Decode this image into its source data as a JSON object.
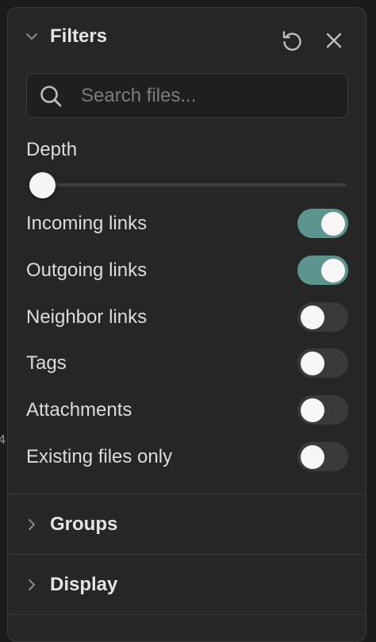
{
  "background_glyph": "4",
  "filters": {
    "title": "Filters",
    "reset_icon": "rotate-ccw-icon",
    "close_icon": "close-icon",
    "search": {
      "placeholder": "Search files...",
      "value": ""
    },
    "depth": {
      "label": "Depth",
      "value_fraction": 0
    },
    "toggles": [
      {
        "label": "Incoming links",
        "on": true
      },
      {
        "label": "Outgoing links",
        "on": true
      },
      {
        "label": "Neighbor links",
        "on": false
      },
      {
        "label": "Tags",
        "on": false
      },
      {
        "label": "Attachments",
        "on": false
      },
      {
        "label": "Existing files only",
        "on": false
      }
    ]
  },
  "groups": {
    "title": "Groups"
  },
  "display": {
    "title": "Display"
  },
  "colors": {
    "panel_bg": "#262626",
    "toggle_on": "#5b958d",
    "toggle_off": "#3a3a3a",
    "text": "#dcdcdc",
    "placeholder": "#7c7c7c"
  }
}
